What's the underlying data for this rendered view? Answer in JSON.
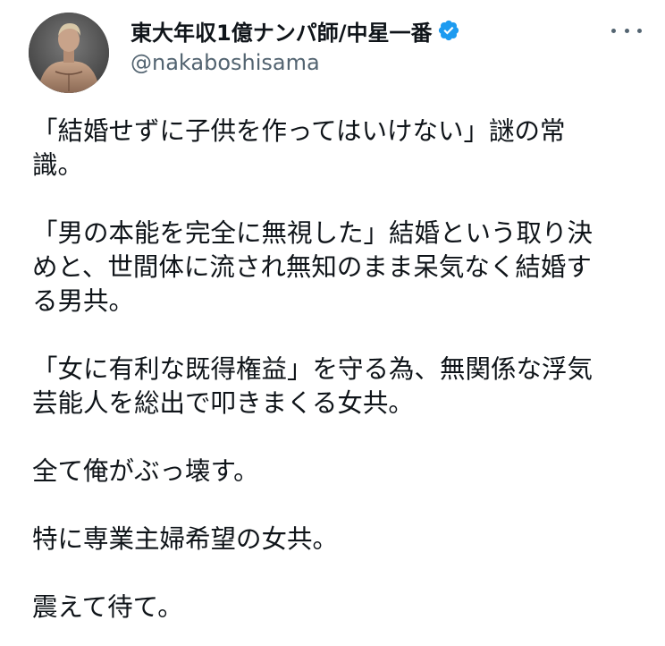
{
  "tweet": {
    "author": {
      "display_name": "東大年収1億ナンパ師/中星一番",
      "handle": "@nakaboshisama",
      "verified": true,
      "avatar_icon": "profile-photo"
    },
    "more_icon": "more-horizontal-icon",
    "paragraphs": [
      "「結婚せずに子供を作ってはいけない」謎の常\n識。",
      "「男の本能を完全に無視した」結婚という取り決\nめと、世間体に流され無知のまま呆気なく結婚す\nる男共。",
      "「女に有利な既得権益」を守る為、無関係な浮気\n芸能人を総出で叩きまくる女共。",
      "全て俺がぶっ壊す。",
      "特に専業主婦希望の女共。",
      "震えて待て。"
    ]
  },
  "colors": {
    "text_primary": "#0f1419",
    "text_secondary": "#536471",
    "verified_blue": "#1d9bf0",
    "background": "#ffffff"
  }
}
